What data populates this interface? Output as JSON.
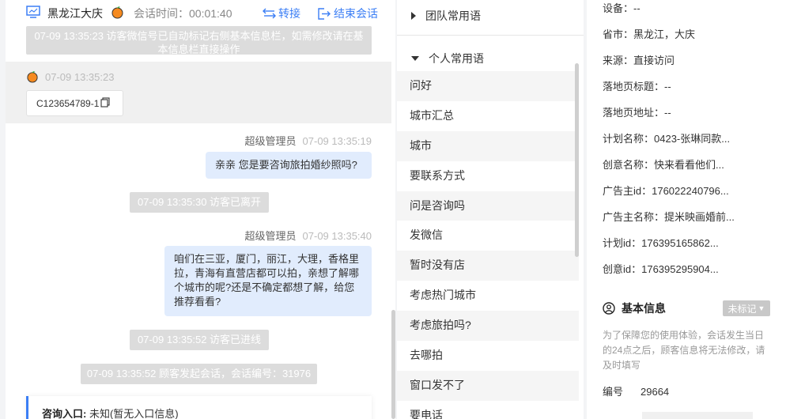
{
  "chat": {
    "visitor_name": "黑龙江大庆",
    "session_time": "会话时间：00:01:40",
    "transfer_label": "转接",
    "end_label": "结束会话",
    "top_notice": "07-09 13:35:23 访客微信号已自动标记右侧基本信息栏，如需修改请在基本信息栏直接操作",
    "visitor_msg_time": "07-09 13:35:23",
    "visitor_id": "C123654789-1",
    "messages": [
      {
        "sender": "超级管理员",
        "time": "07-09 13:35:19",
        "text": "亲亲 您是要咨询旅拍婚纱照吗?"
      },
      {
        "system": "07-09 13:35:30 访客已离开"
      },
      {
        "sender": "超级管理员",
        "time": "07-09 13:35:40",
        "text": "咱们在三亚，厦门，丽江，大理，香格里拉，青海有直营店都可以拍，亲想了解哪个城市的呢?还是不确定都想了解，给您推荐看看?"
      },
      {
        "system": "07-09 13:35:52 访客已进线"
      },
      {
        "system": "07-09 13:35:52 顾客发起会话，会话编号：31976"
      }
    ],
    "entry_label": "咨询入口:",
    "entry_value": "未知(暂无入口信息)"
  },
  "phrases": {
    "team_label": "团队常用语",
    "personal_label": "个人常用语",
    "items": [
      "问好",
      "城市汇总",
      "城市",
      "要联系方式",
      "问是咨询吗",
      "发微信",
      "暂时没有店",
      "考虑热门城市",
      "考虑旅拍吗?",
      "去哪拍",
      "窗口发不了",
      "要电话"
    ]
  },
  "info": {
    "rows": [
      "设备：--",
      "省市：黑龙江，大庆",
      "来源：直接访问",
      "落地页标题：--",
      "落地页地址：--",
      "计划名称：0423-张琳同款...",
      "创意名称：快来看看他们...",
      "广告主id：176022240796...",
      "广告主名称：提米映画婚前...",
      "计划id：176395165862...",
      "创意id：176395295904..."
    ],
    "basic_title": "基本信息",
    "tag_label": "未标记",
    "tip": "为了保障您的使用体验，会话发生当日的24点之后，顾客信息将无法修改，请及时填写",
    "number_label": "编号",
    "number_value": "29664"
  },
  "colors": {
    "accent": "#3b7ef5",
    "bubble": "#e1ecfd",
    "system": "#dcdcdc"
  }
}
